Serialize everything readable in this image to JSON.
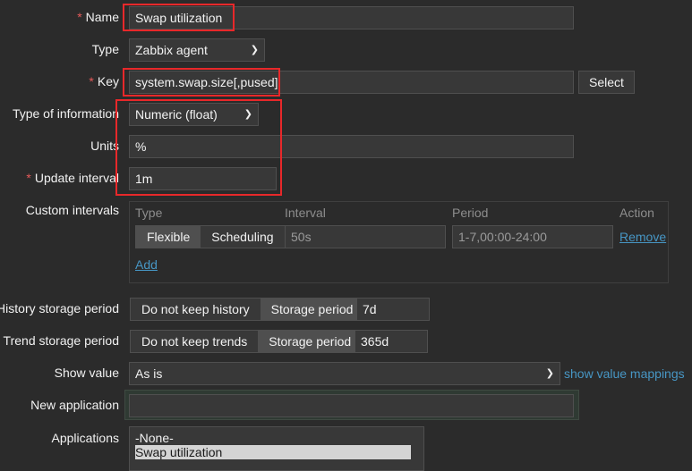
{
  "form": {
    "name": {
      "label": "Name",
      "value": "Swap utilization"
    },
    "type": {
      "label": "Type",
      "value": "Zabbix agent"
    },
    "key": {
      "label": "Key",
      "value": "system.swap.size[,pused]",
      "select_button": "Select"
    },
    "type_of_information": {
      "label": "Type of information",
      "value": "Numeric (float)"
    },
    "units": {
      "label": "Units",
      "value": "%"
    },
    "update_interval": {
      "label": "Update interval",
      "value": "1m"
    },
    "custom_intervals": {
      "label": "Custom intervals",
      "headers": {
        "type": "Type",
        "interval": "Interval",
        "period": "Period",
        "action": "Action"
      },
      "row": {
        "flexible": "Flexible",
        "scheduling": "Scheduling",
        "interval_placeholder": "50s",
        "period_placeholder": "1-7,00:00-24:00",
        "remove": "Remove"
      },
      "add": "Add"
    },
    "history": {
      "label": "History storage period",
      "option_none": "Do not keep history",
      "option_period": "Storage period",
      "value": "7d"
    },
    "trend": {
      "label": "Trend storage period",
      "option_none": "Do not keep trends",
      "option_period": "Storage period",
      "value": "365d"
    },
    "show_value": {
      "label": "Show value",
      "value": "As is",
      "mappings_link": "show value mappings"
    },
    "new_application": {
      "label": "New application",
      "value": ""
    },
    "applications": {
      "label": "Applications",
      "items": [
        "-None-",
        "Swap utilization"
      ]
    }
  },
  "colors": {
    "highlight_box": "#e8282a",
    "required_asterisk": "#e45959",
    "link": "#4796c4"
  }
}
